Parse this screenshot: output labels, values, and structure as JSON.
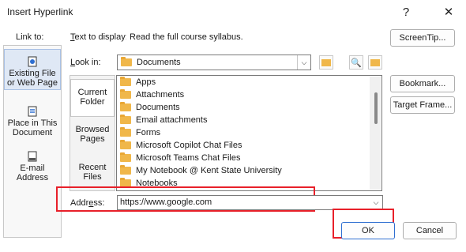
{
  "dialog": {
    "title": "Insert Hyperlink",
    "help_glyph": "?",
    "close_glyph": "✕"
  },
  "link_to": {
    "label": "Link to:",
    "items": [
      {
        "label": "Existing File or Web Page",
        "icon": "web-page-icon",
        "selected": true
      },
      {
        "label": "Place in This Document",
        "icon": "document-place-icon",
        "selected": false
      },
      {
        "label": "E-mail Address",
        "icon": "email-icon",
        "selected": false
      }
    ]
  },
  "text_to_display": {
    "label": "Text to display:",
    "value": "Read the full course syllabus."
  },
  "screentip_button": "ScreenTip...",
  "look_in": {
    "label": "Look in:",
    "value": "Documents"
  },
  "browse_tabs": [
    {
      "label": "Current Folder",
      "selected": true
    },
    {
      "label": "Browsed Pages",
      "selected": false
    },
    {
      "label": "Recent Files",
      "selected": false
    }
  ],
  "files": [
    "Apps",
    "Attachments",
    "Documents",
    "Email attachments",
    "Forms",
    "Microsoft Copilot Chat Files",
    "Microsoft Teams Chat Files",
    "My Notebook @ Kent State University",
    "Notebooks"
  ],
  "side_buttons": {
    "bookmark": "Bookmark...",
    "target_frame": "Target Frame..."
  },
  "address": {
    "label": "Address:",
    "value": "https://www.google.com"
  },
  "ok_button": "OK",
  "cancel_button": "Cancel",
  "colors": {
    "highlight_box": "#e8202a",
    "folder": "#f0b74a",
    "selected_tab": "#dfe8f5"
  }
}
